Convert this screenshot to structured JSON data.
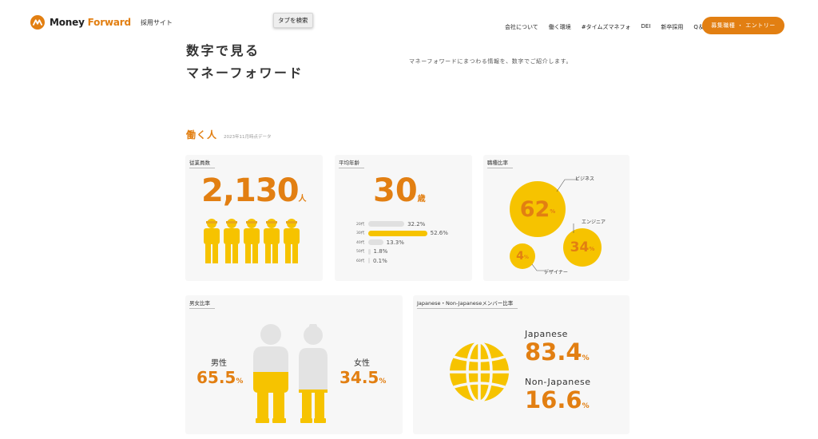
{
  "header": {
    "logo_text_a": "Money ",
    "logo_text_b": "Forward",
    "logo_sub": "採用サイト",
    "tooltip": "タブを検索",
    "nav": [
      "会社について",
      "働く環境",
      "#タイムズマネフォ",
      "DEI",
      "新卒採用",
      "Q＆A"
    ],
    "entry_button": "募集職種 ・ エントリー"
  },
  "hero": {
    "title_line1": "数字で見る",
    "title_line2": "マネーフォワード",
    "description": "マネーフォワードにまつわる情報を、数字でご紹介します。"
  },
  "section": {
    "title": "働く人",
    "date": "2023年11月時点データ"
  },
  "employees": {
    "label": "従業員数",
    "value": "2,130",
    "unit": "人"
  },
  "age": {
    "label": "平均年齢",
    "value": "30",
    "unit": "歳",
    "rows": [
      {
        "label": "20代",
        "value": "32.2%",
        "fraction": 0.322,
        "highlight": false
      },
      {
        "label": "30代",
        "value": "52.6%",
        "fraction": 0.526,
        "highlight": true
      },
      {
        "label": "40代",
        "value": "13.3%",
        "fraction": 0.133,
        "highlight": false
      },
      {
        "label": "50代",
        "value": "1.8%",
        "fraction": 0.018,
        "highlight": false
      },
      {
        "label": "60代",
        "value": "0.1%",
        "fraction": 0.001,
        "highlight": false
      }
    ]
  },
  "jobs": {
    "label": "職種比率",
    "business": {
      "name": "ビジネス",
      "value": "62",
      "pct": "%"
    },
    "engineer": {
      "name": "エンジニア",
      "value": "34",
      "pct": "%"
    },
    "designer": {
      "name": "デザイナー",
      "value": "4",
      "pct": "%"
    }
  },
  "gender": {
    "label": "男女比率",
    "male_label": "男性",
    "male_value": "65.5",
    "female_label": "女性",
    "female_value": "34.5",
    "pct": "%",
    "male_fraction": 0.655,
    "female_fraction": 0.345
  },
  "nationality": {
    "label": "Japanese・Non-Japaneseメンバー比率",
    "japanese_label": "Japanese",
    "japanese_value": "83.4",
    "non_japanese_label": "Non-Japanese",
    "non_japanese_value": "16.6",
    "pct": "%"
  },
  "colors": {
    "accent": "#e27f12",
    "yellow": "#f6c300",
    "grey": "#e0e0e0",
    "card": "#f7f7f7"
  }
}
